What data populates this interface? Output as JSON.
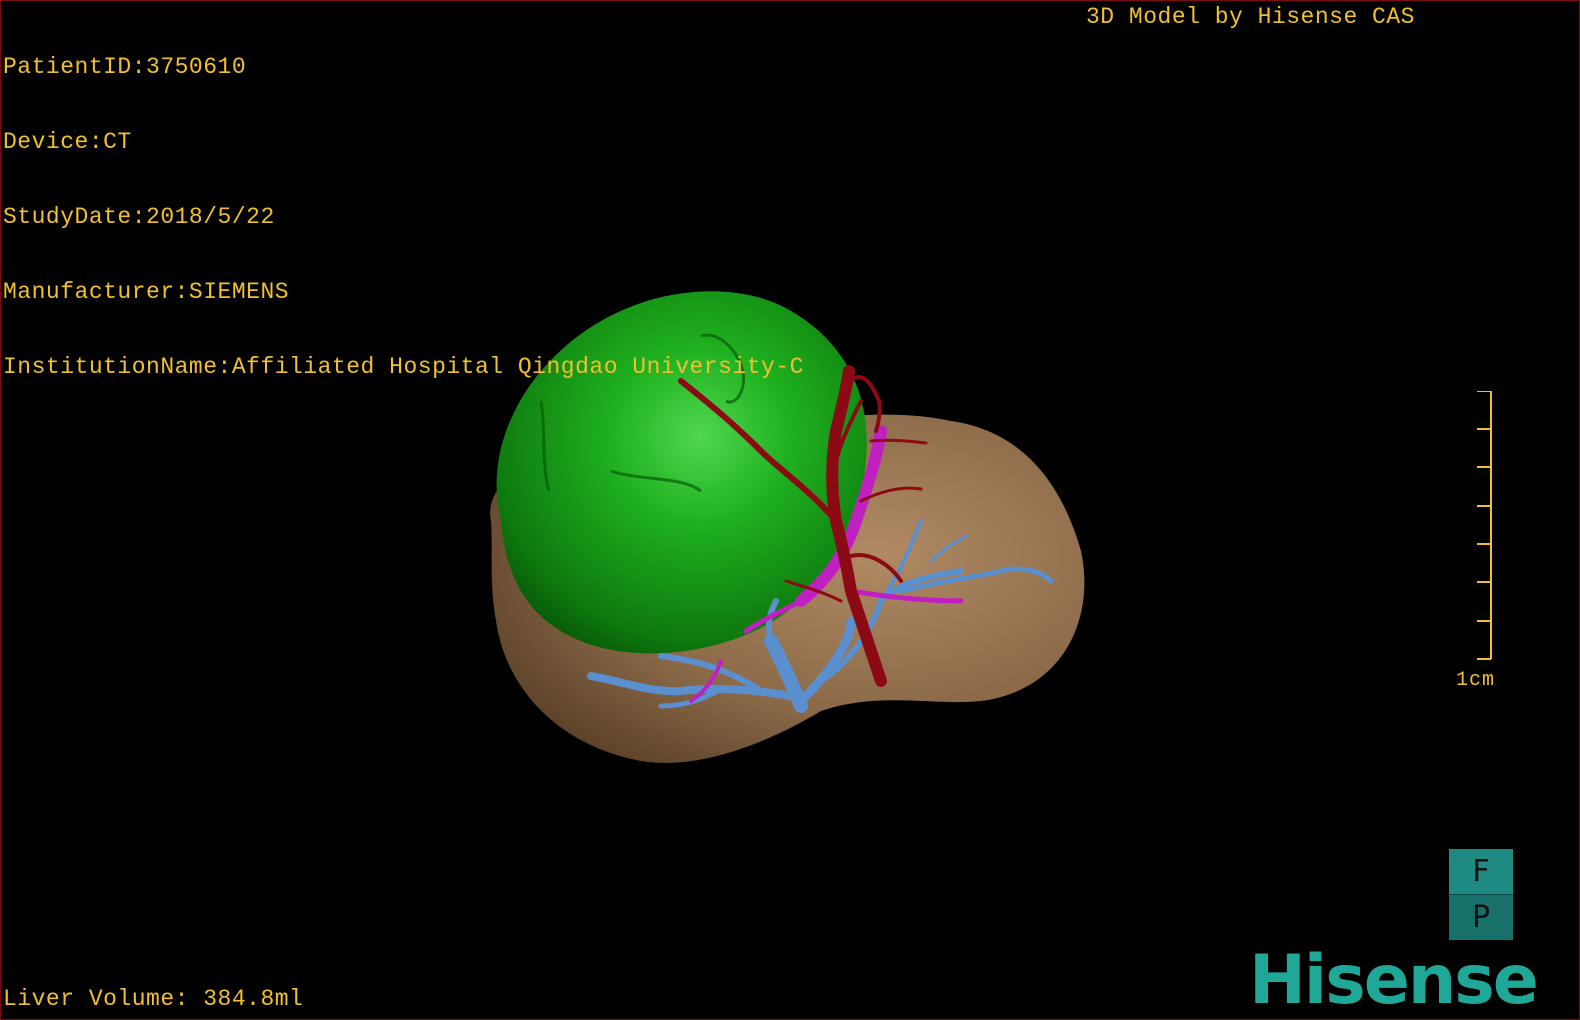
{
  "patient_info": {
    "patient_id": "PatientID:3750610",
    "device": "Device:CT",
    "study_date": "StudyDate:2018/5/22",
    "manufacturer": "Manufacturer:SIEMENS",
    "institution": "InstitutionName:Affiliated Hospital Qingdao University-C"
  },
  "watermark": "3D Model by Hisense CAS",
  "liver_volume": "Liver Volume: 384.8ml",
  "scale": {
    "label": "1cm"
  },
  "orientation_cube": {
    "top_face": "F",
    "bottom_face": "P"
  },
  "brand_logo": "Hisense",
  "colors": {
    "overlay_text": "#f0c030",
    "tumor": "#1fa01f",
    "liver": "#8c6a48",
    "hepatic_artery": "#8b0a14",
    "portal_vein": "#5a8fd0",
    "hepatic_vein": "#c020c0",
    "brand": "#1fa898",
    "cube": "#1e8a82"
  }
}
